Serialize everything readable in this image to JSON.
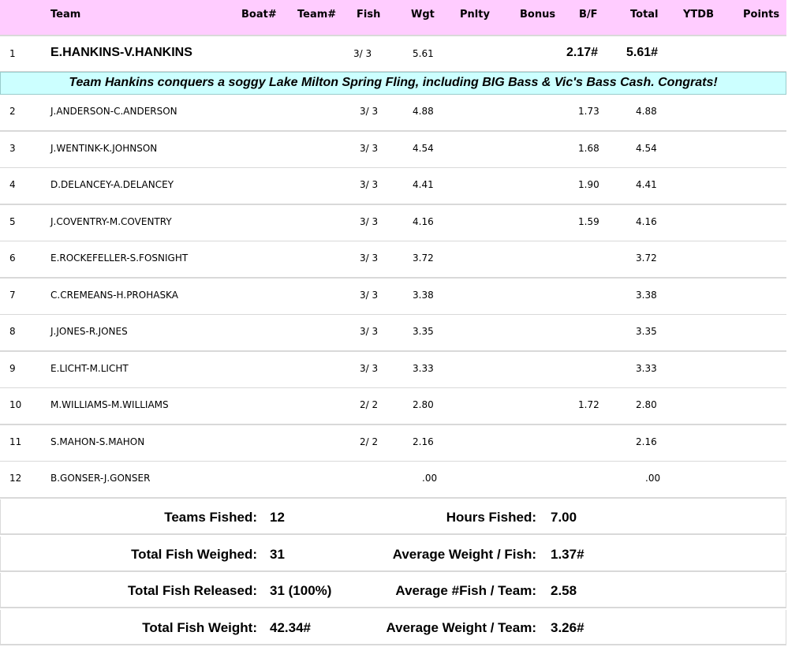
{
  "header": {
    "team": "Team",
    "boat": "Boat#",
    "teamnum": "Team#",
    "fish": "Fish",
    "wgt": "Wgt",
    "pnlty": "Pnlty",
    "bonus": "Bonus",
    "bf": "B/F",
    "total": "Total",
    "ytdb": "YTDB",
    "points": "Points"
  },
  "winner": {
    "place": "1",
    "team": "E.HANKINS-V.HANKINS",
    "fish": "3/ 3",
    "wgt": "5.61",
    "bf": "2.17#",
    "total": "5.61#"
  },
  "banner": "Team Hankins conquers a soggy Lake Milton Spring Fling, including BIG Bass & Vic's Bass Cash. Congrats!",
  "rows": [
    {
      "place": "2",
      "team": "J.ANDERSON-C.ANDERSON",
      "fish": "3/ 3",
      "wgt": "4.88",
      "bf": "1.73",
      "total": "4.88"
    },
    {
      "place": "3",
      "team": "J.WENTINK-K.JOHNSON",
      "fish": "3/ 3",
      "wgt": "4.54",
      "bf": "1.68",
      "total": "4.54"
    },
    {
      "place": "4",
      "team": "D.DELANCEY-A.DELANCEY",
      "fish": "3/ 3",
      "wgt": "4.41",
      "bf": "1.90",
      "total": "4.41"
    },
    {
      "place": "5",
      "team": "J.COVENTRY-M.COVENTRY",
      "fish": "3/ 3",
      "wgt": "4.16",
      "bf": "1.59",
      "total": "4.16"
    },
    {
      "place": "6",
      "team": "E.ROCKEFELLER-S.FOSNIGHT",
      "fish": "3/ 3",
      "wgt": "3.72",
      "bf": "",
      "total": "3.72"
    },
    {
      "place": "7",
      "team": "C.CREMEANS-H.PROHASKA",
      "fish": "3/ 3",
      "wgt": "3.38",
      "bf": "",
      "total": "3.38"
    },
    {
      "place": "8",
      "team": "J.JONES-R.JONES",
      "fish": "3/ 3",
      "wgt": "3.35",
      "bf": "",
      "total": "3.35"
    },
    {
      "place": "9",
      "team": "E.LICHT-M.LICHT",
      "fish": "3/ 3",
      "wgt": "3.33",
      "bf": "",
      "total": "3.33"
    },
    {
      "place": "10",
      "team": "M.WILLIAMS-M.WILLIAMS",
      "fish": "2/ 2",
      "wgt": "2.80",
      "bf": "1.72",
      "total": "2.80"
    },
    {
      "place": "11",
      "team": "S.MAHON-S.MAHON",
      "fish": "2/ 2",
      "wgt": "2.16",
      "bf": "",
      "total": "2.16"
    },
    {
      "place": "12",
      "team": "B.GONSER-J.GONSER",
      "fish": "",
      "wgt": ".00",
      "bf": "",
      "total": ".00"
    }
  ],
  "summary": [
    {
      "l1": "Teams Fished:",
      "v1": "12",
      "l2": "Hours Fished:",
      "v2": "7.00"
    },
    {
      "l1": "Total Fish Weighed:",
      "v1": "31",
      "l2": "Average Weight / Fish:",
      "v2": "1.37#"
    },
    {
      "l1": "Total Fish Released:",
      "v1": "31 (100%)",
      "l2": "Average #Fish / Team:",
      "v2": "2.58"
    },
    {
      "l1": "Total Fish Weight:",
      "v1": "42.34#",
      "l2": "Average Weight / Team:",
      "v2": "3.26#"
    }
  ],
  "colors": {
    "header_bg": "#ffccff",
    "banner_bg": "#ccffff",
    "divider": "#d9d9d9"
  }
}
